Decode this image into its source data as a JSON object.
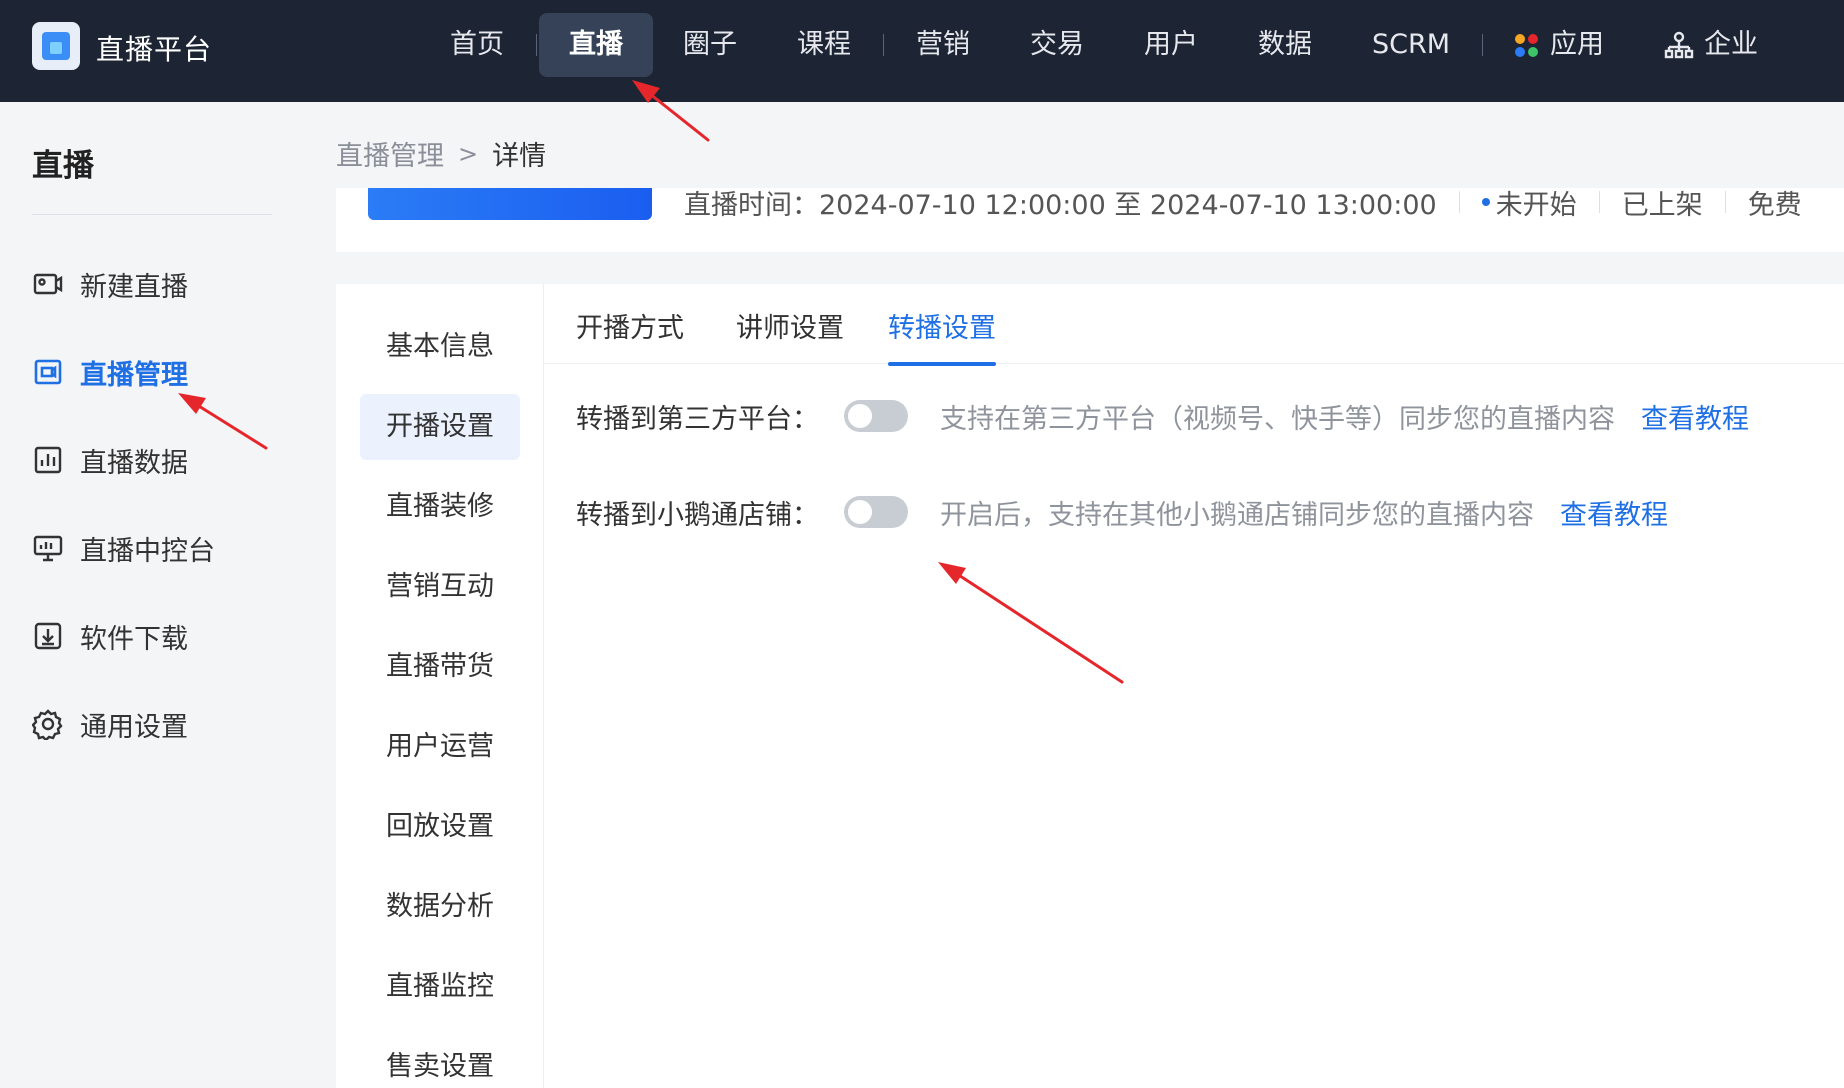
{
  "header": {
    "brand": "直播平台",
    "nav": [
      {
        "label": "首页"
      },
      {
        "label": "直播",
        "active": true
      },
      {
        "label": "圈子"
      },
      {
        "label": "课程"
      },
      {
        "label": "营销"
      },
      {
        "label": "交易"
      },
      {
        "label": "用户"
      },
      {
        "label": "数据"
      },
      {
        "label": "SCRM"
      },
      {
        "label": "应用"
      },
      {
        "label": "企业"
      }
    ]
  },
  "sidebar": {
    "title": "直播",
    "items": [
      {
        "label": "新建直播",
        "icon": "video-camera-icon"
      },
      {
        "label": "直播管理",
        "icon": "live-manage-icon",
        "active": true
      },
      {
        "label": "直播数据",
        "icon": "bar-chart-icon"
      },
      {
        "label": "直播中控台",
        "icon": "monitor-icon"
      },
      {
        "label": "软件下载",
        "icon": "download-icon"
      },
      {
        "label": "通用设置",
        "icon": "gear-icon"
      }
    ]
  },
  "breadcrumb": {
    "parent": "直播管理",
    "separator": ">",
    "current": "详情"
  },
  "info": {
    "time_label": "直播时间：",
    "time_value": "2024-07-10 12:00:00 至 2024-07-10 13:00:00",
    "status": "未开始",
    "shelf": "已上架",
    "price": "免费"
  },
  "subnav": [
    {
      "label": "基本信息"
    },
    {
      "label": "开播设置",
      "active": true
    },
    {
      "label": "直播装修"
    },
    {
      "label": "营销互动"
    },
    {
      "label": "直播带货"
    },
    {
      "label": "用户运营"
    },
    {
      "label": "回放设置"
    },
    {
      "label": "数据分析"
    },
    {
      "label": "直播监控"
    },
    {
      "label": "售卖设置"
    }
  ],
  "tabs": [
    {
      "label": "开播方式"
    },
    {
      "label": "讲师设置"
    },
    {
      "label": "转播设置",
      "active": true
    }
  ],
  "settings": [
    {
      "label": "转播到第三方平台：",
      "enabled": false,
      "description": "支持在第三方平台（视频号、快手等）同步您的直播内容",
      "link": "查看教程"
    },
    {
      "label": "转播到小鹅通店铺：",
      "enabled": false,
      "description": "开启后，支持在其他小鹅通店铺同步您的直播内容",
      "link": "查看教程"
    }
  ],
  "colors": {
    "topbar": "#1d2433",
    "accent": "#1f6fe5",
    "annotation": "#e5262b"
  }
}
